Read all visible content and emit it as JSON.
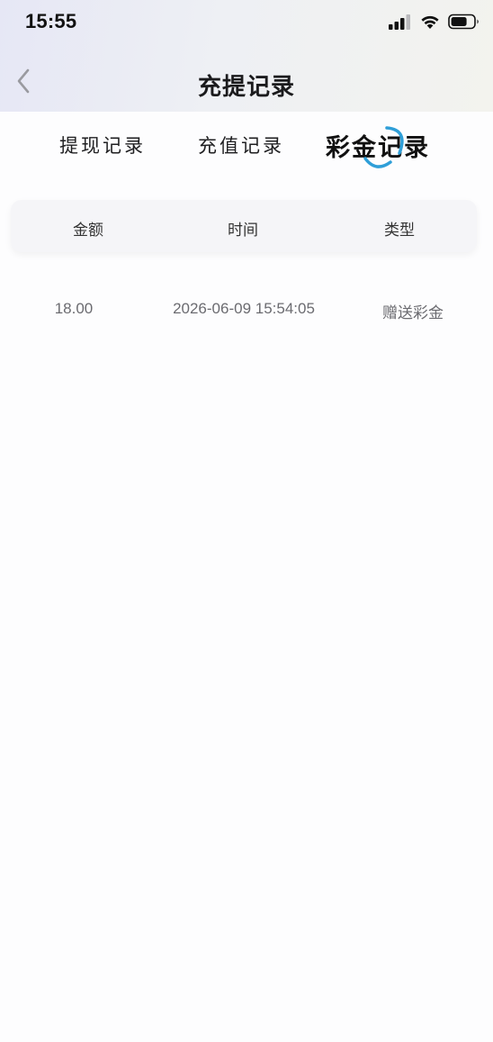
{
  "status_bar": {
    "time": "15:55",
    "icons": [
      "cellular-signal-icon",
      "wifi-icon",
      "battery-icon"
    ]
  },
  "nav": {
    "title": "充提记录",
    "back_icon": "chevron-left-icon"
  },
  "tabs": [
    {
      "label": "提现记录",
      "active": false
    },
    {
      "label": "充值记录",
      "active": false
    },
    {
      "label": "彩金记录",
      "active": true
    }
  ],
  "table": {
    "headers": [
      "金额",
      "时间",
      "类型"
    ],
    "rows": [
      {
        "amount": "18.00",
        "time": "2026-06-09 15:54:05",
        "type": "赠送彩金"
      }
    ]
  },
  "colors": {
    "accent": "#2f9fd8",
    "header_bg": "#f5f5f8",
    "row_text": "#6b6b70"
  }
}
